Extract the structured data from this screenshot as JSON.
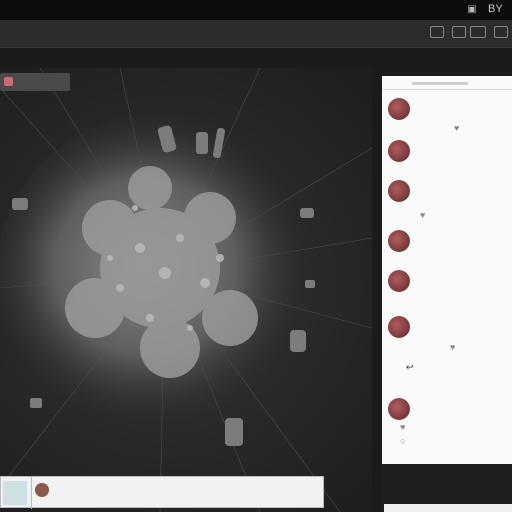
{
  "titlebar": {
    "text": "BY"
  },
  "stage": {
    "tag": "",
    "caption": ""
  },
  "panel": {
    "rows": [
      {
        "title": "",
        "sub": ""
      },
      {
        "title": "",
        "sub": ""
      },
      {
        "title": "",
        "sub": ""
      },
      {
        "title": "",
        "sub": ""
      },
      {
        "title": "",
        "sub": ""
      },
      {
        "title": "",
        "sub": ""
      },
      {
        "title": "",
        "sub": ""
      },
      {
        "title": "",
        "sub": ""
      }
    ],
    "footer_title": ""
  },
  "bottom_bar": {
    "name": "",
    "sub": ""
  },
  "colors": {
    "accent": "#c86a7a",
    "panel_bg": "#fafafa",
    "stage_bg": "#2a2a2a"
  }
}
